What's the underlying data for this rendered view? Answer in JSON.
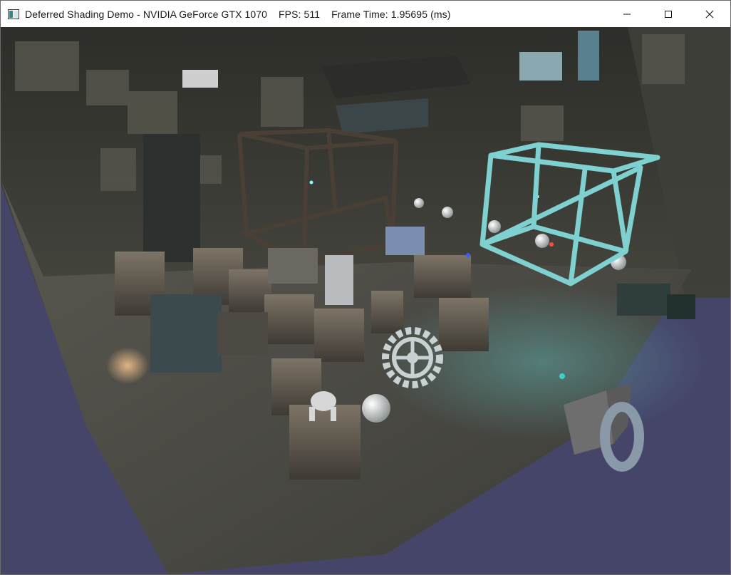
{
  "window": {
    "title": "Deferred Shading Demo - NVIDIA GeForce GTX 1070    FPS: 511    Frame Time: 1.95695 (ms)",
    "icon": "app-window-icon",
    "controls": [
      {
        "name": "minimize-icon",
        "glyph": "minimize"
      },
      {
        "name": "maximize-icon",
        "glyph": "maximize"
      },
      {
        "name": "close-icon",
        "glyph": "close"
      }
    ]
  },
  "scene": {
    "background_color": "#45456a",
    "floor_color": "#4a4942",
    "wall_color": "#3a3a34",
    "accent_cyan": "#7fd1d1"
  }
}
